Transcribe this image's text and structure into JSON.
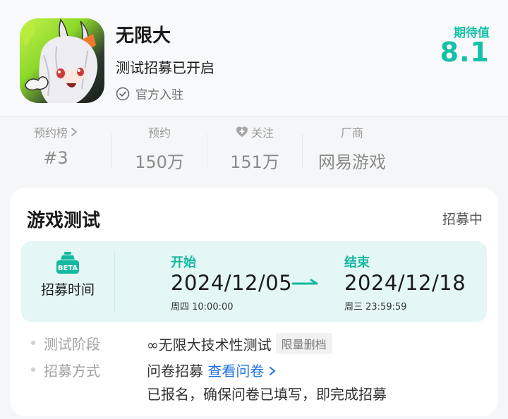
{
  "app": {
    "name": "无限大",
    "subtitle": "测试招募已开启",
    "official_label": "官方入驻",
    "expect_label": "期待值",
    "expect_score": "8.1",
    "accent_color": "#14c0a8"
  },
  "stats": [
    {
      "label": "预约榜",
      "has_chevron": true,
      "value": "#3"
    },
    {
      "label": "预约",
      "value": "150万"
    },
    {
      "label": "关注",
      "has_icon": "heart-plus-icon",
      "value": "151万"
    },
    {
      "label": "厂商",
      "value": "网易游戏"
    }
  ],
  "test_card": {
    "title": "游戏测试",
    "status": "招募中",
    "icon_badge": "BETA",
    "recruit_time_label": "招募时间",
    "start": {
      "title": "开始",
      "date": "2024/12/05",
      "time": "周四  10:00:00"
    },
    "end": {
      "title": "结束",
      "date": "2024/12/18",
      "time": "周三  23:59:59"
    },
    "phase_label": "测试阶段",
    "phase_value": "∞无限大技术性测试",
    "phase_tag": "限量删档",
    "method_label": "招募方式",
    "method_value": "问卷招募",
    "method_link": "查看问卷",
    "method_note": "已报名，确保问卷已填写，即完成招募"
  }
}
